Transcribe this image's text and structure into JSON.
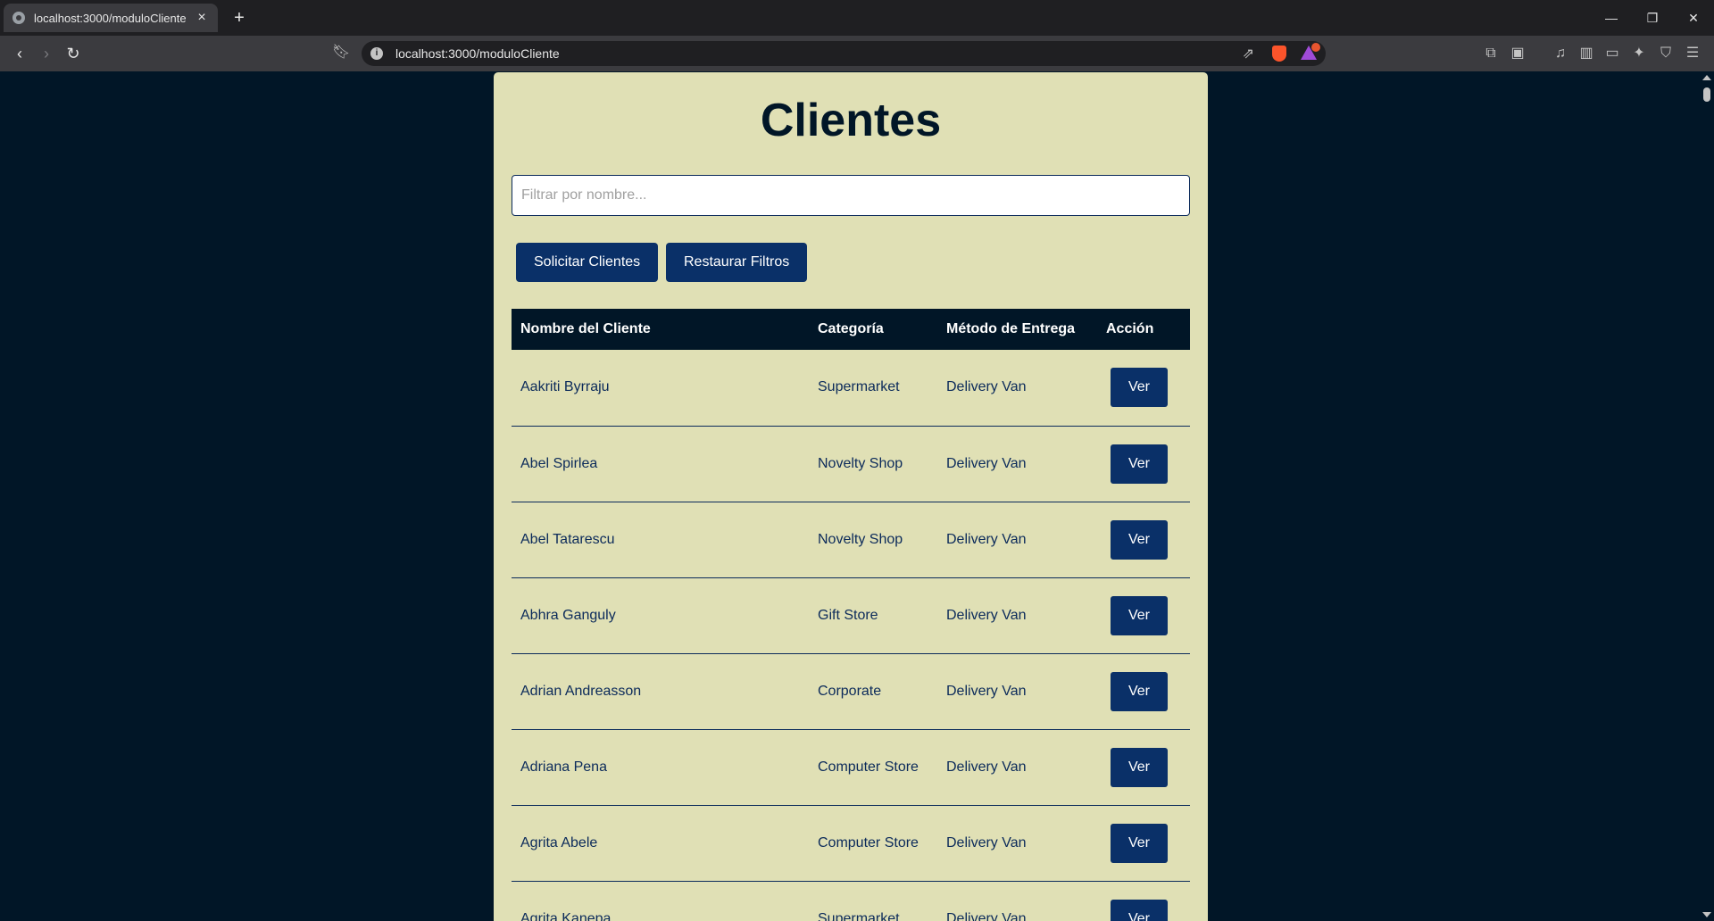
{
  "browser": {
    "tab_title": "localhost:3000/moduloCliente",
    "tab_close": "×",
    "new_tab": "+",
    "url": "localhost:3000/moduloCliente"
  },
  "page": {
    "title": "Clientes",
    "filter_placeholder": "Filtrar por nombre...",
    "buttons": {
      "request": "Solicitar Clientes",
      "reset": "Restaurar Filtros"
    },
    "table": {
      "headers": [
        "Nombre del Cliente",
        "Categoría",
        "Método de Entrega",
        "Acción"
      ],
      "action_label": "Ver",
      "rows": [
        {
          "name": "Aakriti Byrraju",
          "category": "Supermarket",
          "delivery": "Delivery Van"
        },
        {
          "name": "Abel Spirlea",
          "category": "Novelty Shop",
          "delivery": "Delivery Van"
        },
        {
          "name": "Abel Tatarescu",
          "category": "Novelty Shop",
          "delivery": "Delivery Van"
        },
        {
          "name": "Abhra Ganguly",
          "category": "Gift Store",
          "delivery": "Delivery Van"
        },
        {
          "name": "Adrian Andreasson",
          "category": "Corporate",
          "delivery": "Delivery Van"
        },
        {
          "name": "Adriana Pena",
          "category": "Computer Store",
          "delivery": "Delivery Van"
        },
        {
          "name": "Agrita Abele",
          "category": "Computer Store",
          "delivery": "Delivery Van"
        },
        {
          "name": "Agrita Kanepa",
          "category": "Supermarket",
          "delivery": "Delivery Van"
        }
      ]
    }
  },
  "colors": {
    "page_bg": "#011627",
    "panel_bg": "#e0e0b5",
    "button_bg": "#0a3068",
    "table_header_bg": "#011627"
  }
}
